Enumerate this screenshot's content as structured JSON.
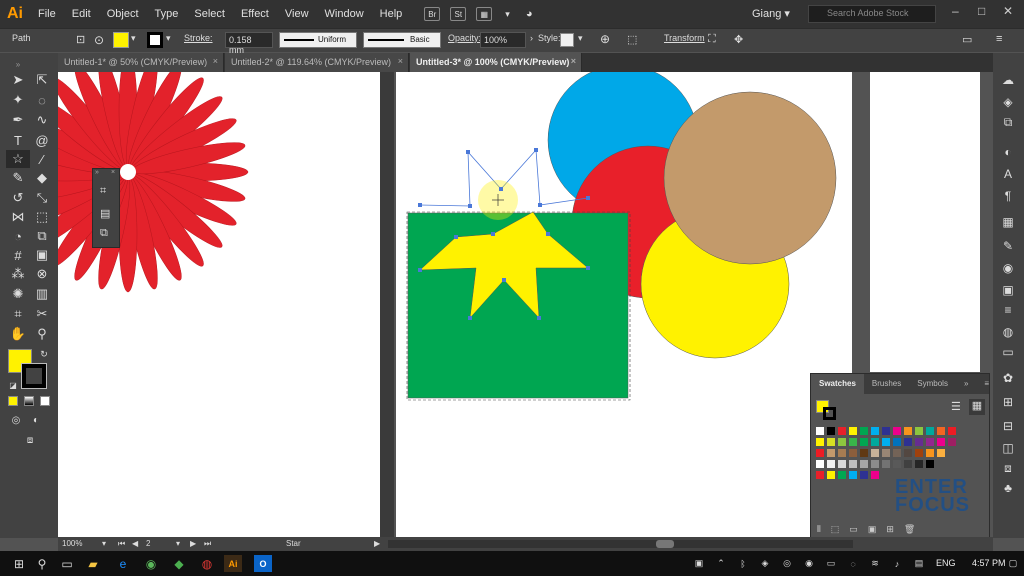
{
  "app": {
    "logo": "Ai",
    "menus": [
      "File",
      "Edit",
      "Object",
      "Type",
      "Select",
      "Effect",
      "View",
      "Window",
      "Help"
    ],
    "bridge_btn": "Br",
    "stock_btn": "St",
    "user": "Giang",
    "search_placeholder": "Search Adobe Stock"
  },
  "control_bar": {
    "selection_type": "Path",
    "fill_color": "#fff200",
    "stroke_label": "Stroke:",
    "stroke_weight": "0.158 mm",
    "profile": "Uniform",
    "brush": "Basic",
    "opacity_label": "Opacity:",
    "opacity": "100%",
    "style_label": "Style:",
    "transform_label": "Transform"
  },
  "tabs": [
    {
      "label": "Untitled-1* @ 50% (CMYK/Preview)",
      "active": false
    },
    {
      "label": "Untitled-2* @ 119.64% (CMYK/Preview)",
      "active": false
    },
    {
      "label": "Untitled-3* @ 100% (CMYK/Preview)",
      "active": true
    }
  ],
  "tools_panel": {
    "fill_color": "#fff200",
    "stroke_color": "#000000"
  },
  "canvas_colors": {
    "flower": "#e3222b",
    "blue": "#00a8e8",
    "red": "#e8202a",
    "tan": "#c39a6b",
    "yellow": "#fff200",
    "green": "#00a651",
    "star": "#fff200"
  },
  "swatches_panel": {
    "tabs": [
      "Swatches",
      "Brushes",
      "Symbols"
    ],
    "active_tab": "Swatches",
    "row1": [
      "#ffffff",
      "#000000",
      "#e8202a",
      "#fff200",
      "#00a651",
      "#00aeef",
      "#2e3192",
      "#ec008c",
      "#f7941d",
      "#8dc63f",
      "#00a99d",
      "#f26522",
      "#ed1c24"
    ],
    "row2": [
      "#fff200",
      "#d7df23",
      "#8dc63f",
      "#39b54a",
      "#00a651",
      "#00a99d",
      "#00aeef",
      "#0072bc",
      "#2e3192",
      "#662d91",
      "#92278f",
      "#ec008c",
      "#9e1f63"
    ],
    "row3": [
      "#ed1c24",
      "#c49a6c",
      "#a67c52",
      "#8b5e3c",
      "#603913",
      "#c7b299",
      "#998675",
      "#736357",
      "#534741",
      "#a0410d",
      "#f7941d",
      "#fbb040"
    ],
    "row4": [
      "#ffffff",
      "#f2f2f2",
      "#d9d9d9",
      "#bfbfbf",
      "#a6a6a6",
      "#8c8c8c",
      "#737373",
      "#595959",
      "#404040",
      "#262626",
      "#000000"
    ],
    "row5": [
      "#e8202a",
      "#fff200",
      "#00a651",
      "#00aeef",
      "#2e3192",
      "#ec008c"
    ]
  },
  "watermark": {
    "line1": "ENTER",
    "line2": "FOCUS"
  },
  "status_bar": {
    "zoom": "100%",
    "artboard": "2",
    "tool": "Star"
  },
  "taskbar": {
    "lang": "ENG",
    "time": "4:57 PM"
  }
}
